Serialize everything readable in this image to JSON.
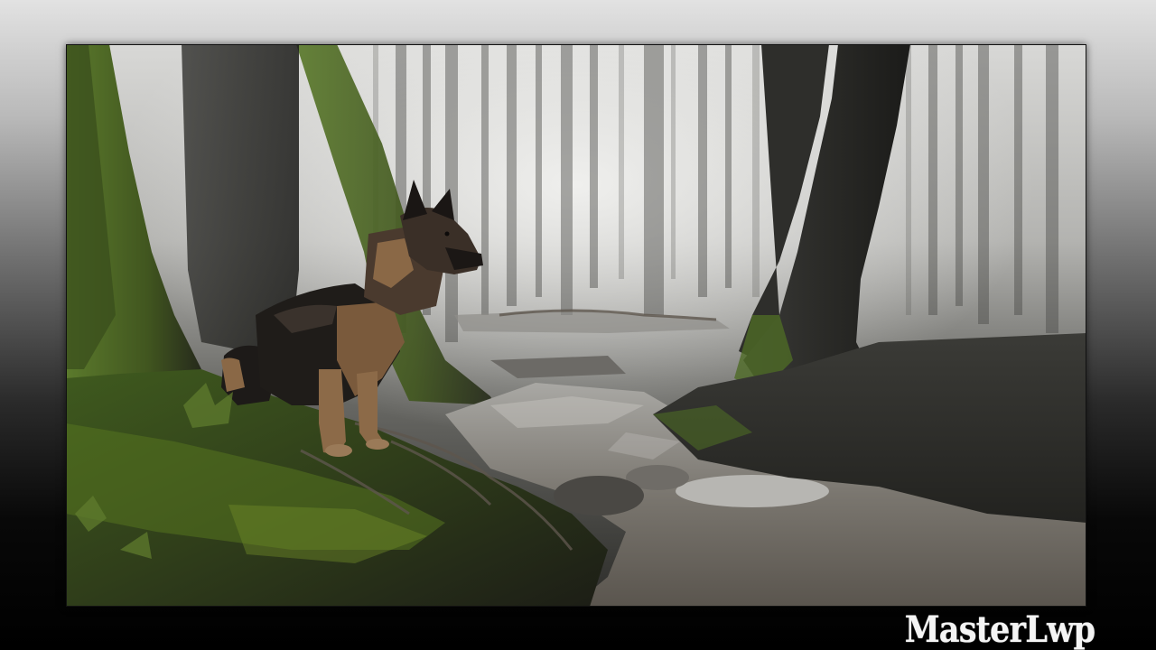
{
  "wallpaper": {
    "watermark": "MasterLwp",
    "background_gradient": [
      "#e2e2e2",
      "#000000"
    ],
    "frame_border_color": "#1a1a1a"
  },
  "scene": {
    "subject": "dog-icon",
    "palette": {
      "fog": "#c9c9c9",
      "moss": "#4f6b26",
      "bark": "#2b2b28",
      "water": "#6f6a63",
      "fur_tan": "#8a6846",
      "fur_dark": "#1d1a18"
    }
  }
}
